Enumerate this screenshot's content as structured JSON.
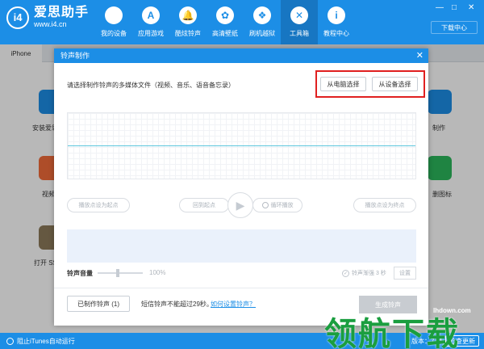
{
  "app": {
    "name": "爱思助手",
    "url": "www.i4.cn",
    "logo_glyph": "i4"
  },
  "nav": [
    {
      "label": "我的设备",
      "icon": "apple-icon",
      "glyph": ""
    },
    {
      "label": "应用游戏",
      "icon": "app-store-icon",
      "glyph": "A"
    },
    {
      "label": "酷炫铃声",
      "icon": "bell-icon",
      "glyph": "🔔"
    },
    {
      "label": "高清壁纸",
      "icon": "flower-icon",
      "glyph": "✿"
    },
    {
      "label": "刷机越狱",
      "icon": "box-icon",
      "glyph": "❖"
    },
    {
      "label": "工具箱",
      "icon": "tools-icon",
      "glyph": "✕",
      "active": true
    },
    {
      "label": "教程中心",
      "icon": "info-icon",
      "glyph": "i"
    }
  ],
  "window_controls": {
    "minimize": "—",
    "restore": "□",
    "close": "✕"
  },
  "download_center": "下载中心",
  "tabs": {
    "device": "iPhone"
  },
  "background_apps": [
    {
      "label": "安装爱思",
      "color": "#1c8ee6"
    },
    {
      "label": "视频",
      "color": "#f26b3a"
    },
    {
      "label": "打开 SS",
      "color": "#8c7a5b"
    },
    {
      "label": "制作",
      "color": "#1c8ee6"
    },
    {
      "label": "删图标",
      "color": "#2cb75c"
    }
  ],
  "dialog": {
    "title": "铃声制作",
    "close_glyph": "✕",
    "prompt": "请选择制作铃声的多媒体文件（视频、音乐、语音备忘录）",
    "from_computer": "从电脑选择",
    "from_device": "从设备选择",
    "set_start": "播放点设为起点",
    "back_to_start": "回到起点",
    "loop_play": "循环播放",
    "set_end": "播放点设为终点",
    "play_glyph": "▶",
    "volume_label": "铃声音量",
    "volume_value": "100%",
    "volume_level": 0.45,
    "fade_label": "铃声渐强 3 秒",
    "settings": "设置",
    "made_ringtones": "已制作铃声 (1)",
    "limit_note": "短信铃声不能超过29秒。",
    "howto_link": "如何设置铃声？",
    "generate": "生成铃声"
  },
  "statusbar": {
    "itunes_autorun": "阻止iTunes自动运行",
    "version": "版本：7.11",
    "check_update": "检查更新"
  },
  "watermark": {
    "url": "lhdown.com",
    "text": "领航下载"
  },
  "colors": {
    "brand_blue": "#1c8ee6",
    "highlight_red": "#e02020",
    "watermark_green": "#1a9e3f"
  }
}
